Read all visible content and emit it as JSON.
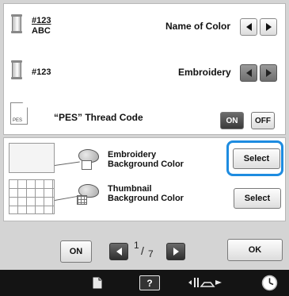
{
  "settings": {
    "name_of_color": {
      "icon": "thread-spool-icon",
      "code_label": "#123",
      "code_sublabel": "ABC",
      "label": "Name of Color"
    },
    "embroidery": {
      "icon": "thread-spool-icon",
      "code_label": "#123",
      "label": "Embroidery"
    },
    "pes_thread_code": {
      "icon": "file-icon",
      "file_icon_text": "PES",
      "label": "“PES” Thread Code",
      "on_label": "ON",
      "off_label": "OFF",
      "selected": "ON"
    }
  },
  "background": {
    "embroidery_bg": {
      "label_line1": "Embroidery",
      "label_line2": "Background Color",
      "button": "Select",
      "highlighted": true
    },
    "thumbnail_bg": {
      "label_line1": "Thumbnail",
      "label_line2": "Background Color",
      "button": "Select"
    }
  },
  "navigation": {
    "on_label": "ON",
    "page_current": "1",
    "page_separator": "/",
    "page_total": "7",
    "ok_label": "OK"
  },
  "bottom_bar": {
    "icons": [
      "page-icon",
      "help-icon",
      "needle-presser-foot-icon",
      "clock-icon"
    ],
    "help_glyph": "?"
  },
  "colors": {
    "highlight": "#1e8ce0",
    "bottom_bar": "#141414",
    "panel_background": "#d4d4d4"
  }
}
